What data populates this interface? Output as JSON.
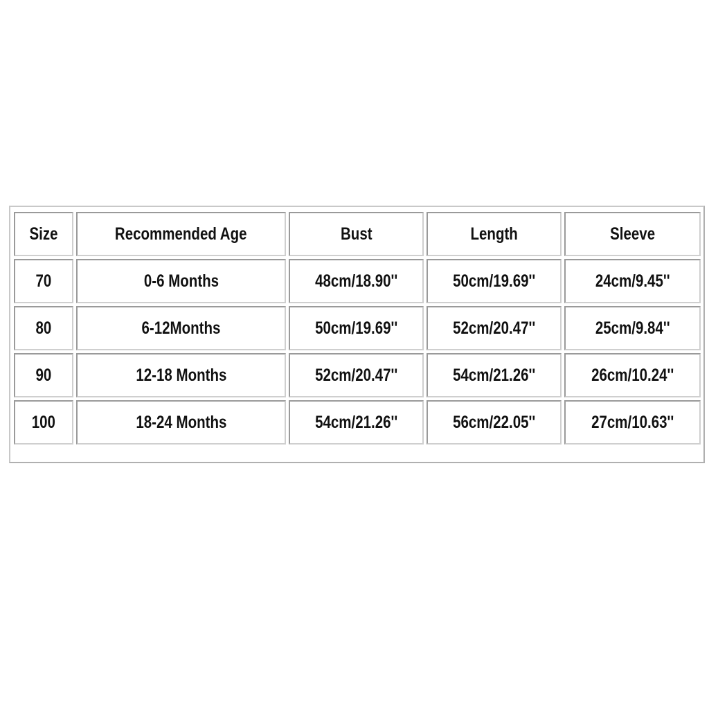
{
  "table": {
    "headers": [
      "Size",
      "Recommended Age",
      "Bust",
      "Length",
      "Sleeve"
    ],
    "rows": [
      [
        "70",
        "0-6 Months",
        "48cm/18.90''",
        "50cm/19.69''",
        "24cm/9.45''"
      ],
      [
        "80",
        "6-12Months",
        "50cm/19.69''",
        "52cm/20.47''",
        "25cm/9.84''"
      ],
      [
        "90",
        "12-18 Months",
        "52cm/20.47''",
        "54cm/21.26''",
        "26cm/10.24''"
      ],
      [
        "100",
        "18-24 Months",
        "54cm/21.26''",
        "56cm/22.05''",
        "27cm/10.63''"
      ]
    ]
  }
}
